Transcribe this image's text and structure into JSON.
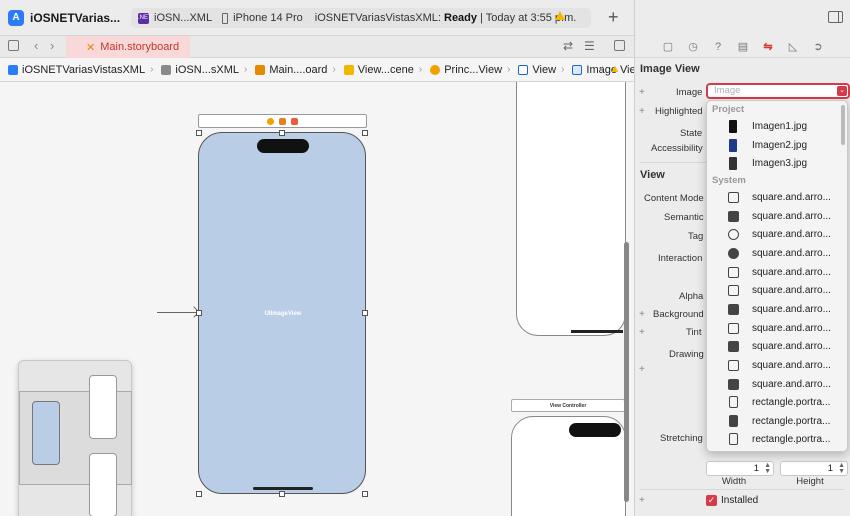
{
  "toolbar": {
    "project_name": "iOSNETVarias...",
    "scheme_name": "iOSN...XML",
    "device": "iPhone 14 Pro",
    "status_prefix": "iOSNETVariasVistasXML:",
    "status_state": "Ready",
    "status_suffix": "| Today at 3:55 p.m.",
    "add_label": "+"
  },
  "tabbar": {
    "active_tab": "Main.storyboard"
  },
  "breadcrumb": [
    {
      "label": "iOSNETVariasVistasXML",
      "color": "#2a7df4"
    },
    {
      "label": "iOSN...sXML",
      "color": "#8a8a8a"
    },
    {
      "label": "Main....oard",
      "color": "#e68a00"
    },
    {
      "label": "View...cene",
      "color": "#f2b800"
    },
    {
      "label": "Princ...View",
      "color": "#f2a000"
    },
    {
      "label": "View",
      "color": "#1a66d9"
    },
    {
      "label": "Image View",
      "color": "#1a66d9"
    }
  ],
  "canvas": {
    "uiimageview_label": "UIImageView",
    "view_controller_label": "View Controller"
  },
  "inspector": {
    "section_image_view": "Image View",
    "label_image": "Image",
    "image_placeholder": "Image",
    "label_highlighted": "Highlighted",
    "label_state": "State",
    "label_accessibility": "Accessibility",
    "section_view": "View",
    "label_content_mode": "Content Mode",
    "label_semantic": "Semantic",
    "label_tag": "Tag",
    "label_interaction": "Interaction",
    "label_alpha": "Alpha",
    "label_background": "Background",
    "label_tint": "Tint",
    "label_drawing": "Drawing",
    "label_stretching": "Stretching",
    "width_value": "1",
    "height_value": "1",
    "width_label": "Width",
    "height_label": "Height",
    "installed_label": "Installed"
  },
  "dropdown": {
    "group_project": "Project",
    "project_items": [
      "Imagen1.jpg",
      "Imagen2.jpg",
      "Imagen3.jpg"
    ],
    "group_system": "System",
    "system_items": [
      "square.and.arro...",
      "square.and.arro...",
      "square.and.arro...",
      "square.and.arro...",
      "square.and.arro...",
      "square.and.arro...",
      "square.and.arro...",
      "square.and.arro...",
      "square.and.arro...",
      "square.and.arro...",
      "square.and.arro...",
      "rectangle.portra...",
      "rectangle.portra...",
      "rectangle.portra..."
    ]
  },
  "colors": {
    "accent": "#d63b4a",
    "phone_fill": "#b9cde7",
    "tab_active_bg": "#f8d8d8"
  }
}
